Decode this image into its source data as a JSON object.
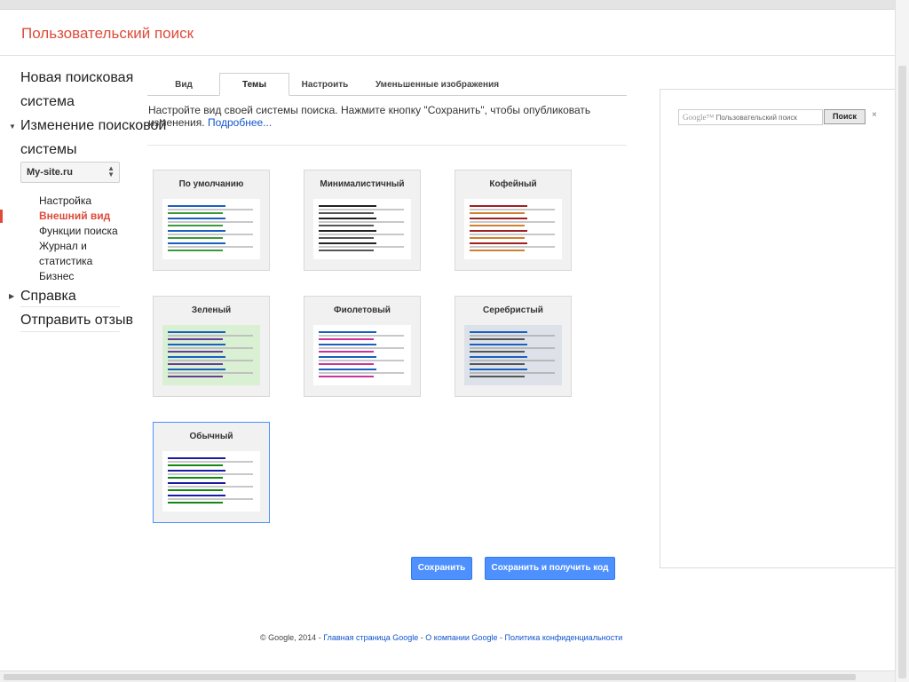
{
  "app": {
    "title": "Пользовательский поиск"
  },
  "sidebar": {
    "new_engine": [
      "Новая поисковая",
      "система"
    ],
    "edit_engine": [
      "Изменение поисковой",
      "системы"
    ],
    "site_select": {
      "value": "My-site.ru"
    },
    "sub_items": [
      "Настройка",
      "Внешний вид",
      "Функции поиска",
      "Журнал и",
      "статистика",
      "Бизнес"
    ],
    "active_sub": "Внешний вид",
    "help": "Справка",
    "feedback": "Отправить отзыв"
  },
  "tabs": [
    {
      "label": "Вид",
      "active": false
    },
    {
      "label": "Темы",
      "active": true
    },
    {
      "label": "Настроить",
      "active": false
    },
    {
      "label": "Уменьшенные изображения",
      "active": false
    }
  ],
  "description": {
    "line1": "Настройте вид своей системы поиска. Нажмите кнопку \"Сохранить\", чтобы опубликовать",
    "line2": "изменения.",
    "more_link": "Подробнее..."
  },
  "themes": [
    {
      "label": "По умолчанию",
      "bg": "#ffffff",
      "title": "#1a5fbf",
      "url": "#3a9a3a",
      "text": "#c8c8c8",
      "selected": false
    },
    {
      "label": "Минималистичный",
      "bg": "#ffffff",
      "title": "#222222",
      "url": "#555555",
      "text": "#c8c8c8",
      "selected": false
    },
    {
      "label": "Кофейный",
      "bg": "#ffffff",
      "title": "#a02020",
      "url": "#d08030",
      "text": "#c8c8c8",
      "selected": false
    },
    {
      "label": "Зеленый",
      "bg": "#d9f0d3",
      "title": "#1a5fbf",
      "url": "#6a3a9a",
      "text": "#c0c0c0",
      "selected": false
    },
    {
      "label": "Фиолетовый",
      "bg": "#ffffff",
      "title": "#1a5fbf",
      "url": "#cc3399",
      "text": "#c8c8c8",
      "selected": false
    },
    {
      "label": "Серебристый",
      "bg": "#dde2ea",
      "title": "#1a5fbf",
      "url": "#555555",
      "text": "#b8b8b8",
      "selected": false
    },
    {
      "label": "Обычный",
      "bg": "#ffffff",
      "title": "#1a1aa6",
      "url": "#118811",
      "text": "#c8c8c8",
      "selected": true
    }
  ],
  "buttons": {
    "save": "Сохранить",
    "save_get_code": "Сохранить и получить код"
  },
  "footer": {
    "copyright": "© Google, 2014",
    "links": [
      "Главная страница Google",
      "О компании Google",
      "Политика конфиденциальности"
    ]
  },
  "search_preview": {
    "logo_text": "Google™",
    "placeholder": "Пользовательский поиск",
    "button": "Поиск",
    "close": "×"
  }
}
